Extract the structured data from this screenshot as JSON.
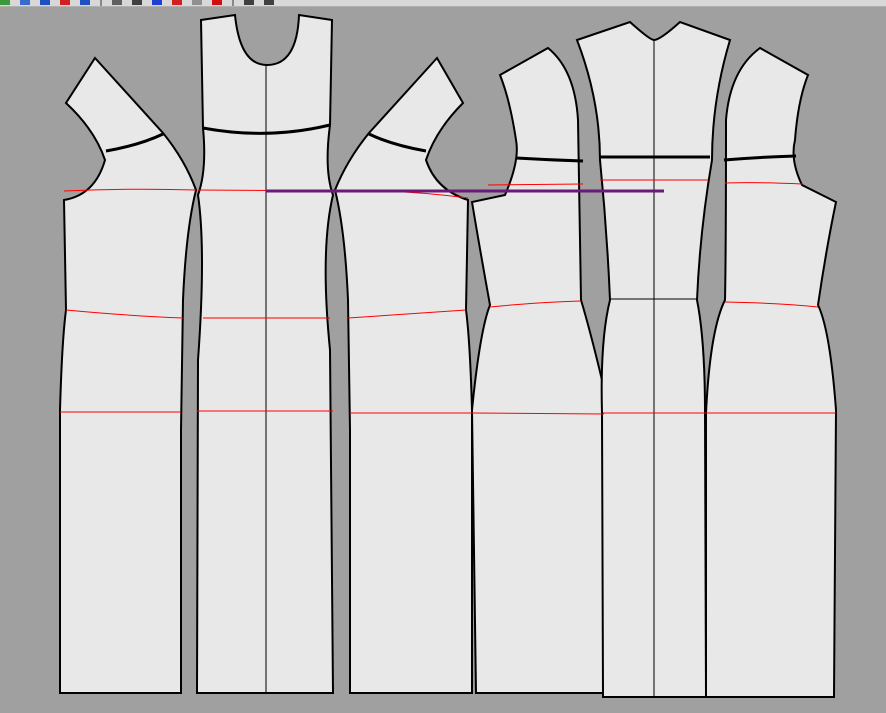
{
  "toolbar": {
    "icons": [
      "new-icon",
      "open-icon",
      "save-icon",
      "undo-icon",
      "redo-icon",
      "pointer-icon",
      "line-icon",
      "curve-icon",
      "measure-icon",
      "grid-icon",
      "marker-icon",
      "ruler-icon",
      "notch-icon"
    ]
  },
  "colors": {
    "canvas": "#a0a0a0",
    "piece_fill": "#e8e8e8",
    "outline": "#000000",
    "guide_line": "#ff0000",
    "selection_line": "#6a1a7a"
  }
}
